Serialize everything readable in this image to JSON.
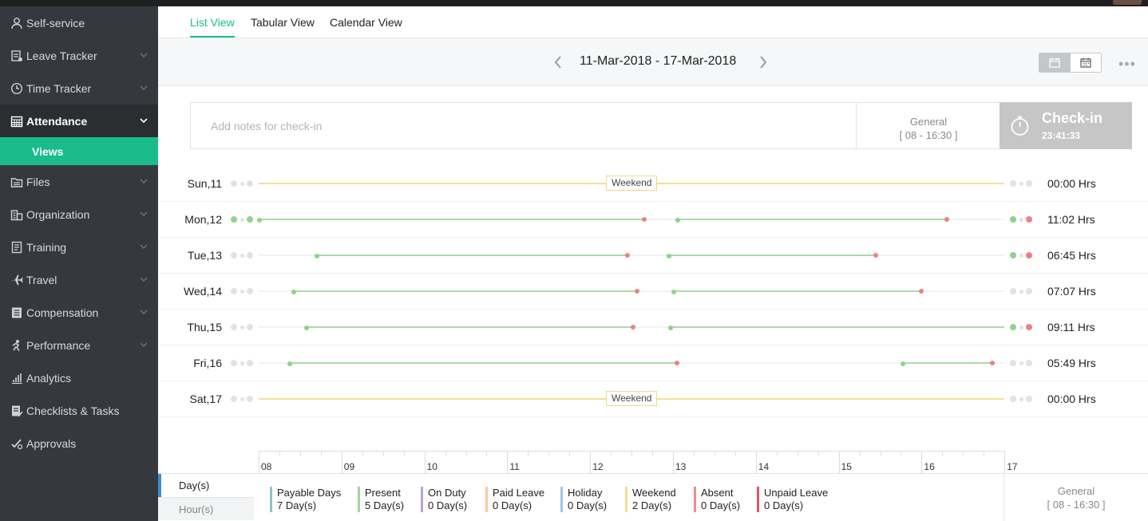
{
  "sidebar": {
    "items": [
      {
        "label": "Self-service",
        "icon": "person-icon",
        "chevron": false
      },
      {
        "label": "Leave Tracker",
        "icon": "leave-icon",
        "chevron": true
      },
      {
        "label": "Time Tracker",
        "icon": "clock-icon",
        "chevron": true
      },
      {
        "label": "Attendance",
        "icon": "calendar-icon",
        "chevron": true,
        "active": true
      },
      {
        "label": "Files",
        "icon": "files-icon",
        "chevron": true
      },
      {
        "label": "Organization",
        "icon": "building-icon",
        "chevron": true
      },
      {
        "label": "Training",
        "icon": "document-icon",
        "chevron": true
      },
      {
        "label": "Travel",
        "icon": "plane-icon",
        "chevron": true
      },
      {
        "label": "Compensation",
        "icon": "list-icon",
        "chevron": true
      },
      {
        "label": "Performance",
        "icon": "performance-icon",
        "chevron": true
      },
      {
        "label": "Analytics",
        "icon": "bar-chart-icon",
        "chevron": false
      },
      {
        "label": "Checklists & Tasks",
        "icon": "checklist-icon",
        "chevron": false
      },
      {
        "label": "Approvals",
        "icon": "approval-icon",
        "chevron": false
      }
    ],
    "sub_item": "Views"
  },
  "tabs": {
    "list": "List View",
    "tabular": "Tabular View",
    "calendar": "Calendar View"
  },
  "week": {
    "range": "11-Mar-2018 - 17-Mar-2018"
  },
  "checkin": {
    "notes_placeholder": "Add notes for check-in",
    "shift_name": "General",
    "shift_time": "[ 08 - 16:30 ]",
    "button_label": "Check-in",
    "timer": "23:41:33"
  },
  "days": [
    {
      "label": "Sun,11",
      "hours": "00:00 Hrs",
      "weekend": true,
      "start": "none",
      "end": "none",
      "sessions": []
    },
    {
      "label": "Mon,12",
      "hours": "11:02 Hrs",
      "weekend": false,
      "start": "green",
      "end": "green-red",
      "sessions": [
        [
          8.0,
          12.65
        ],
        [
          13.05,
          16.3
        ]
      ]
    },
    {
      "label": "Tue,13",
      "hours": "06:45 Hrs",
      "weekend": false,
      "start": "none",
      "end": "green-red",
      "sessions": [
        [
          8.7,
          12.45
        ],
        [
          12.95,
          15.45
        ]
      ]
    },
    {
      "label": "Wed,14",
      "hours": "07:07 Hrs",
      "weekend": false,
      "start": "none",
      "end": "none",
      "sessions": [
        [
          8.42,
          12.57
        ],
        [
          13.0,
          16.0
        ]
      ]
    },
    {
      "label": "Thu,15",
      "hours": "09:11 Hrs",
      "weekend": false,
      "start": "none",
      "end": "green-red",
      "sessions": [
        [
          8.57,
          12.52
        ],
        [
          12.97,
          17.0
        ]
      ]
    },
    {
      "label": "Fri,16",
      "hours": "05:49 Hrs",
      "weekend": false,
      "start": "none",
      "end": "none",
      "sessions": [
        [
          8.37,
          13.05
        ],
        [
          15.77,
          16.85
        ]
      ]
    },
    {
      "label": "Sat,17",
      "hours": "00:00 Hrs",
      "weekend": true,
      "start": "none",
      "end": "none",
      "sessions": []
    }
  ],
  "weekend_label": "Weekend",
  "axis": {
    "ticks": [
      "08",
      "09",
      "10",
      "11",
      "12",
      "13",
      "14",
      "15",
      "16",
      "17"
    ]
  },
  "footer": {
    "day_tab": "Day(s)",
    "hour_tab": "Hour(s)",
    "legend": [
      {
        "label": "Payable Days",
        "value": "7 Day(s)",
        "color": "#8ec3c9"
      },
      {
        "label": "Present",
        "value": "5 Day(s)",
        "color": "#9fd69f"
      },
      {
        "label": "On Duty",
        "value": "0 Day(s)",
        "color": "#b9a3d6"
      },
      {
        "label": "Paid Leave",
        "value": "0 Day(s)",
        "color": "#f7c99a"
      },
      {
        "label": "Holiday",
        "value": "0 Day(s)",
        "color": "#9ec6e8"
      },
      {
        "label": "Weekend",
        "value": "2 Day(s)",
        "color": "#f5dc8c"
      },
      {
        "label": "Absent",
        "value": "0 Day(s)",
        "color": "#f28c8c"
      },
      {
        "label": "Unpaid Leave",
        "value": "0 Day(s)",
        "color": "#e0536a"
      }
    ],
    "shift_name": "General",
    "shift_time": "[ 08 - 16:30 ]"
  },
  "colors": {
    "accent": "#1abc8c",
    "present_line": "#a8dca8",
    "present_dot": "#8fd18f",
    "out_dot": "#f08080",
    "weekend_line": "#f5e08f",
    "idle_dot": "#e2e2e2"
  }
}
